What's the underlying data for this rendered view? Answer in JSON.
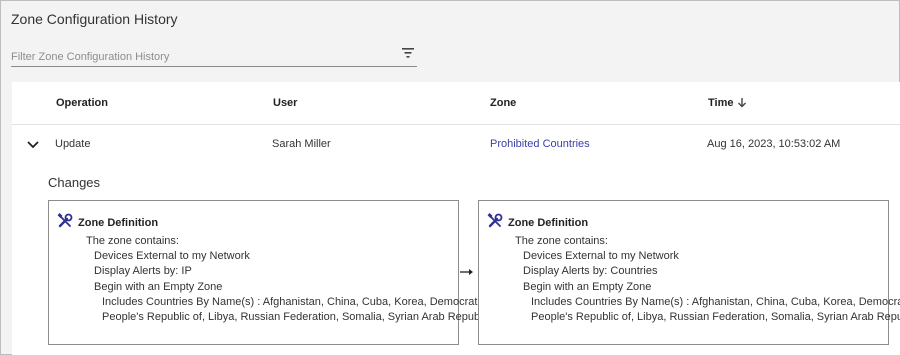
{
  "page": {
    "title": "Zone Configuration History"
  },
  "filter": {
    "placeholder": "Filter Zone Configuration History",
    "icon": "filter-icon"
  },
  "table": {
    "columns": [
      "Operation",
      "User",
      "Zone",
      "Time"
    ],
    "sort": {
      "column": "Time",
      "direction": "descending"
    },
    "rows": [
      {
        "operation": "Update",
        "user": "Sarah Miller",
        "zone": "Prohibited Countries",
        "time": "Aug 16, 2023, 10:53:02 AM",
        "expanded": true
      }
    ]
  },
  "changes": {
    "label": "Changes",
    "before": {
      "title": "Zone Definition",
      "lines": [
        "The zone contains:",
        "Devices External to my Network",
        "Display Alerts by: IP",
        "Begin with an Empty Zone",
        "Includes Countries By Name(s) : Afghanistan, China, Cuba, Korea, Democratic",
        "People's Republic of, Libya, Russian Federation, Somalia, Syrian Arab Republic"
      ]
    },
    "after": {
      "title": "Zone Definition",
      "lines": [
        "The zone contains:",
        "Devices External to my Network",
        "Display Alerts by: Countries",
        "Begin with an Empty Zone",
        "Includes Countries By Name(s) : Afghanistan, China, Cuba, Korea, Democratic",
        "People's Republic of, Libya, Russian Federation, Somalia, Syrian Arab Republic"
      ]
    }
  },
  "colors": {
    "link": "#3a3fa8",
    "icon": "#2e3192",
    "background": "#f3f3f3"
  }
}
